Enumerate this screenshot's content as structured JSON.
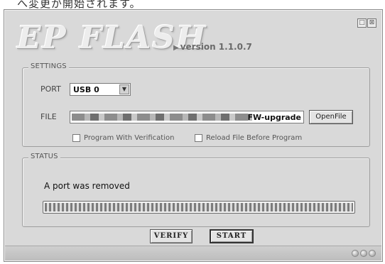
{
  "page_fragment": "へ変更が開始されます。",
  "window": {
    "controls": [
      {
        "name": "minimize-icon",
        "glyph": "□"
      },
      {
        "name": "close-icon",
        "glyph": "⊠"
      }
    ]
  },
  "header": {
    "logo": "EP FLASH",
    "version": "version 1.1.0.7"
  },
  "settings": {
    "title": "SETTINGS",
    "port_label": "PORT",
    "port_value": "USB 0",
    "file_label": "FILE",
    "file_value_visible": "FW-upgrade",
    "open_file_label": "OpenFile",
    "program_with_verification": {
      "label": "Program With Verification",
      "checked": false
    },
    "reload_file_before_program": {
      "label": "Reload File Before Program",
      "checked": false
    }
  },
  "status": {
    "title": "STATUS",
    "message": "A port was removed",
    "progress": 1.0
  },
  "actions": {
    "verify_label": "VERIFY",
    "start_label": "START"
  }
}
